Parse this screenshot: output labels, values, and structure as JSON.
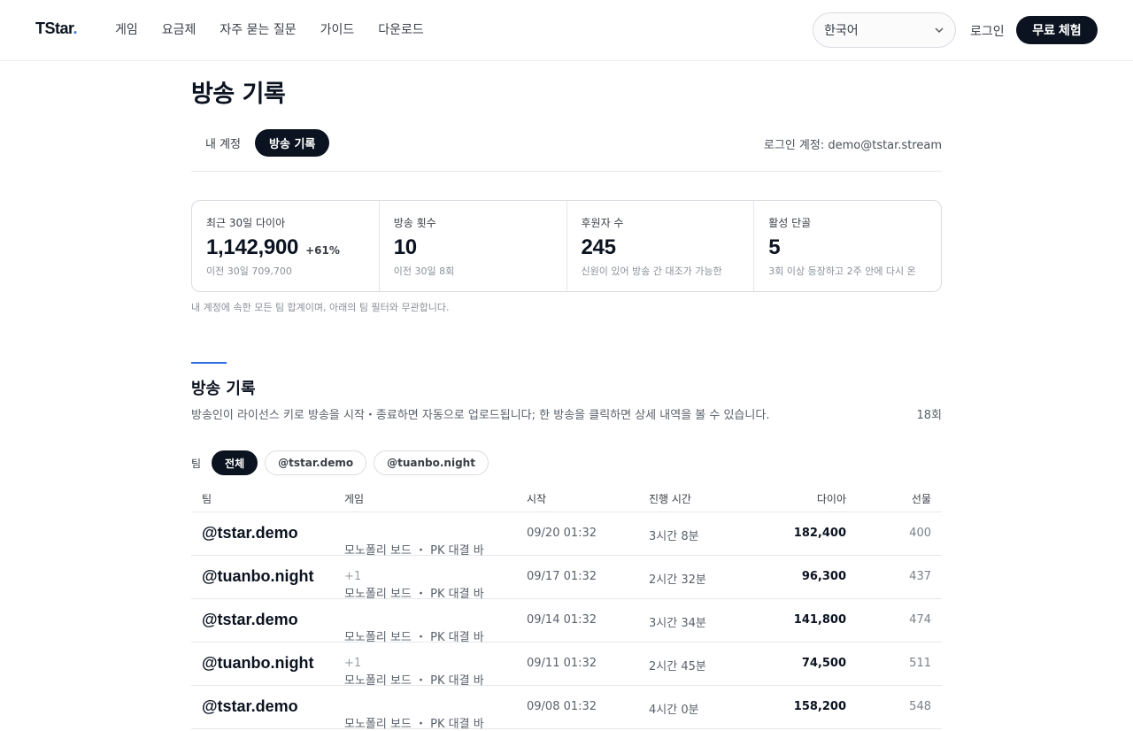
{
  "header": {
    "logo_text": "TStar",
    "logo_dot": ".",
    "nav": [
      "게임",
      "요금제",
      "자주 묻는 질문",
      "가이드",
      "다운로드"
    ],
    "language_selected": "한국어",
    "login_label": "로그인",
    "trial_label": "무료 체험"
  },
  "page": {
    "title": "방송 기록",
    "tabs": [
      "내 계정",
      "방송 기록"
    ],
    "active_tab": "방송 기록",
    "account_text": "로그인 계정: demo@tstar.stream"
  },
  "stats": [
    {
      "label": "최근 30일 다이아",
      "value": "1,142,900",
      "delta": "+61%",
      "note": "이전 30일 709,700"
    },
    {
      "label": "방송 횟수",
      "value": "10",
      "delta": "",
      "note": "이전 30일 8회"
    },
    {
      "label": "후원자 수",
      "value": "245",
      "delta": "",
      "note": "신원이 있어 방송 간 대조가 가능한"
    },
    {
      "label": "활성 단골",
      "value": "5",
      "delta": "",
      "note": "3회 이상 등장하고 2주 안에 다시 온"
    }
  ],
  "stats_footnote": "내 계정에 속한 모든 팀 합계이며, 아래의 팀 필터와 무관합니다.",
  "section": {
    "title": "방송 기록",
    "description": "방송인이 라이선스 키로 방송을 시작・종료하면 자동으로 업로드됩니다; 한 방송을 클릭하면 상세 내역을 볼 수 있습니다.",
    "count": "18회"
  },
  "filter": {
    "label": "팀",
    "chips": [
      "전체",
      "@tstar.demo",
      "@tuanbo.night"
    ],
    "active": "전체"
  },
  "table": {
    "columns": [
      "팀",
      "게임",
      "시작",
      "진행 시간",
      "다이아",
      "선물"
    ],
    "rows": [
      {
        "team": "@tstar.demo",
        "game": "모노폴리 보드 ・ PK 대결 바",
        "extra": "",
        "start": "09/20 01:32",
        "duration": "3시간 8분",
        "dia": "182,400",
        "gifts": "400"
      },
      {
        "team": "@tuanbo.night",
        "game": "모노폴리 보드 ・ PK 대결 바",
        "extra": "+1",
        "start": "09/17 01:32",
        "duration": "2시간 32분",
        "dia": "96,300",
        "gifts": "437"
      },
      {
        "team": "@tstar.demo",
        "game": "모노폴리 보드 ・ PK 대결 바",
        "extra": "",
        "start": "09/14 01:32",
        "duration": "3시간 34분",
        "dia": "141,800",
        "gifts": "474"
      },
      {
        "team": "@tuanbo.night",
        "game": "모노폴리 보드 ・ PK 대결 바",
        "extra": "+1",
        "start": "09/11 01:32",
        "duration": "2시간 45분",
        "dia": "74,500",
        "gifts": "511"
      },
      {
        "team": "@tstar.demo",
        "game": "모노폴리 보드 ・ PK 대결 바",
        "extra": "",
        "start": "09/08 01:32",
        "duration": "4시간 0분",
        "dia": "158,200",
        "gifts": "548"
      }
    ]
  },
  "colors": {
    "primary_dark": "#0b1320",
    "accent": "#2f6fe4"
  }
}
